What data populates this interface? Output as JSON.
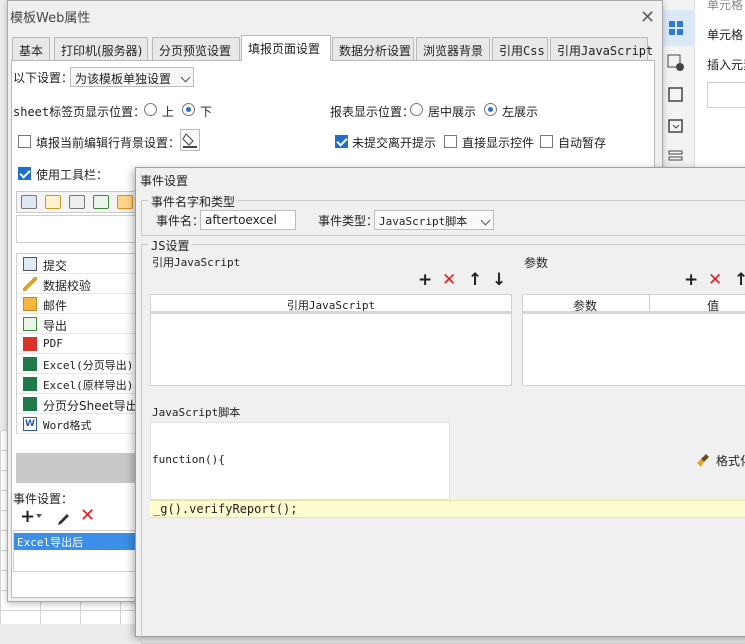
{
  "main_dialog": {
    "title": "模板Web属性",
    "tabs": [
      "基本",
      "打印机(服务器)",
      "分页预览设置",
      "填报页面设置",
      "数据分析设置",
      "浏览器背景",
      "引用Css",
      "引用JavaScript"
    ],
    "active_tab": "填报页面设置",
    "settings_label": "以下设置：",
    "settings_combo": "为该模板单独设置",
    "sheet_tab_pos_label": "sheet标签页显示位置：",
    "radio_top": "上",
    "radio_bottom": "下",
    "report_pos_label": "报表显示位置：",
    "radio_center": "居中展示",
    "radio_left": "左展示",
    "fill_bg_label": "填报当前编辑行背景设置：",
    "unsubmitted_label": "未提交离开提示",
    "direct_show_label": "直接显示控件",
    "autosave_label": "自动暂存",
    "use_toolbar_label": "使用工具栏：",
    "toolbar_items": [
      "提交",
      "数据校验",
      "邮件",
      "导出",
      "PDF",
      "Excel(分页导出)",
      "Excel(原样导出)",
      "分页分Sheet导出",
      "Word格式"
    ],
    "event_settings_label": "事件设置：",
    "event_item": "Excel导出后"
  },
  "event_dialog": {
    "title": "事件设置",
    "group_name_type": "事件名字和类型",
    "event_name_label": "事件名：",
    "event_name_value": "aftertoexcel",
    "event_type_label": "事件类型：",
    "event_type_value": "JavaScript脚本",
    "group_js": "JS设置",
    "ref_js_label": "引用JavaScript",
    "ref_js_column": "引用JavaScript",
    "params_label": "参数",
    "param_col": "参数",
    "value_col": "值",
    "script_label": "JavaScript脚本",
    "code_function": "function(){",
    "code_line": "_g().verifyReport();",
    "format_label": "格式化"
  },
  "right_panel": {
    "label_cell": "单元格",
    "label_insert": "插入元素"
  },
  "colors": {
    "accent": "#1f6fd1",
    "selection": "#3d8ee6",
    "delete_red": "#e02020",
    "code_highlight": "#fdfdd0"
  }
}
